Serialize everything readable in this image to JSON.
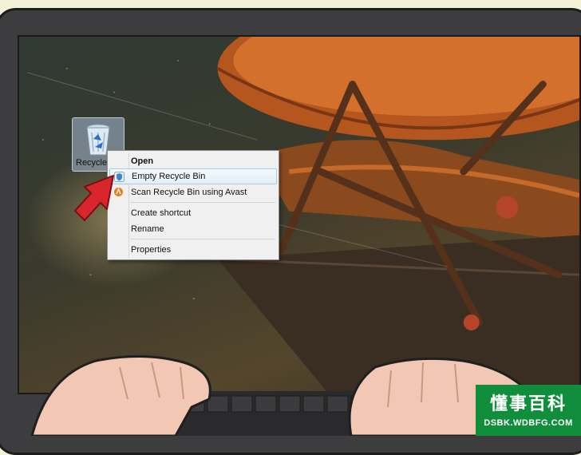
{
  "desktop": {
    "recycle_bin_label": "Recycle",
    "icon": "recycle-bin-icon"
  },
  "context_menu": {
    "items": [
      {
        "label": "Open",
        "bold": true
      },
      {
        "label": "Empty Recycle Bin",
        "highlighted": true,
        "icon": "shield-icon"
      },
      {
        "label": "Scan Recycle Bin using Avast",
        "icon": "avast-icon"
      },
      {
        "label": "Create shortcut"
      },
      {
        "label": "Rename"
      },
      {
        "label": "Properties"
      }
    ]
  },
  "watermark": {
    "title": "懂事百科",
    "url": "DSBK.WDBFG.COM"
  },
  "colors": {
    "pointer": "#d9252c",
    "watermark_bg": "#118e3c",
    "menu_highlight": "#e3eff9"
  }
}
